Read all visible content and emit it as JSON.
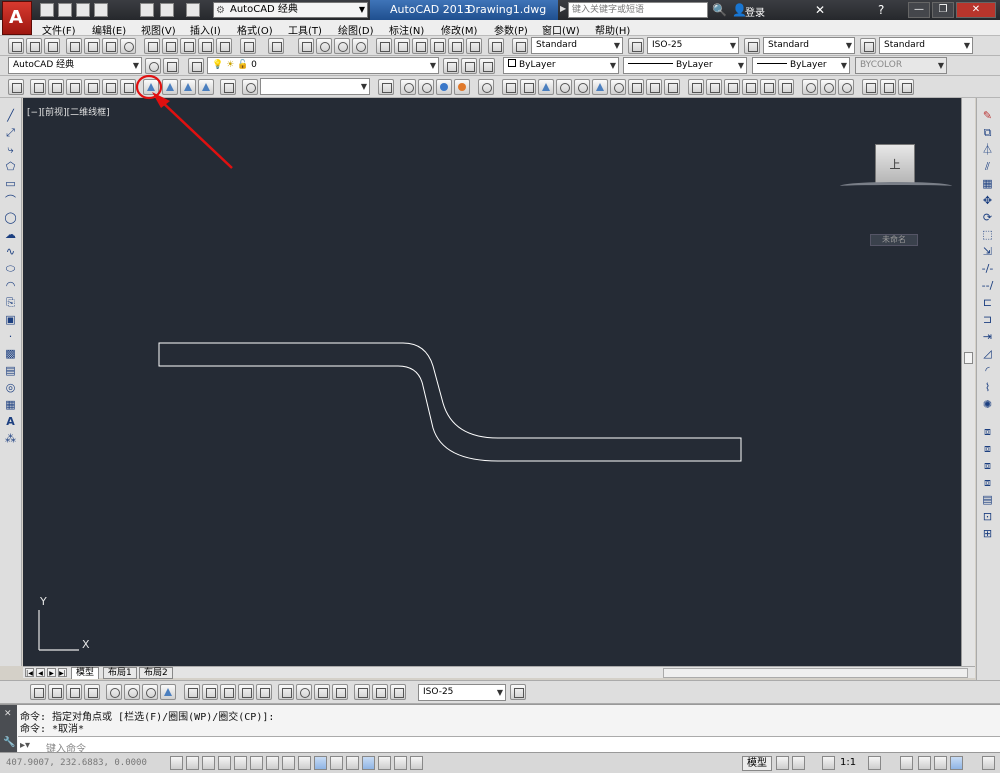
{
  "titlebar": {
    "workspace": "AutoCAD 经典",
    "app_name": "AutoCAD 2013",
    "doc_name": "Drawing1.dwg",
    "search_placeholder": "键入关键字或短语",
    "login": "登录"
  },
  "menus": [
    "文件(F)",
    "编辑(E)",
    "视图(V)",
    "插入(I)",
    "格式(O)",
    "工具(T)",
    "绘图(D)",
    "标注(N)",
    "修改(M)",
    "参数(P)",
    "窗口(W)",
    "帮助(H)"
  ],
  "styles": {
    "text_style": "Standard",
    "dim_style": "ISO-25",
    "table_style": "Standard",
    "multileader_style": "Standard"
  },
  "workspace_combo": "AutoCAD 经典",
  "layer": {
    "name": "0"
  },
  "properties": {
    "color": "ByLayer",
    "linetype": "ByLayer",
    "lineweight": "ByLayer",
    "plotstyle": "BYCOLOR"
  },
  "viewport": {
    "label": "[−][前视][二维线框]",
    "view_face": "上",
    "wcs": "未命名",
    "axis_y": "Y",
    "axis_x": "X",
    "background": "#252b35"
  },
  "tabs": [
    "模型",
    "布局1",
    "布局2"
  ],
  "dim_toolbar": {
    "dim_style": "ISO-25"
  },
  "command": {
    "line1": "命令:  指定对角点或 [栏选(F)/圈围(WP)/圈交(CP)]:",
    "line2": "命令: *取消*",
    "placeholder": "键入命令"
  },
  "status": {
    "coords": "407.9007, 232.6883, 0.0000",
    "model": "模型",
    "scale": "1:1"
  },
  "annotation": {
    "color": "#e01010"
  }
}
